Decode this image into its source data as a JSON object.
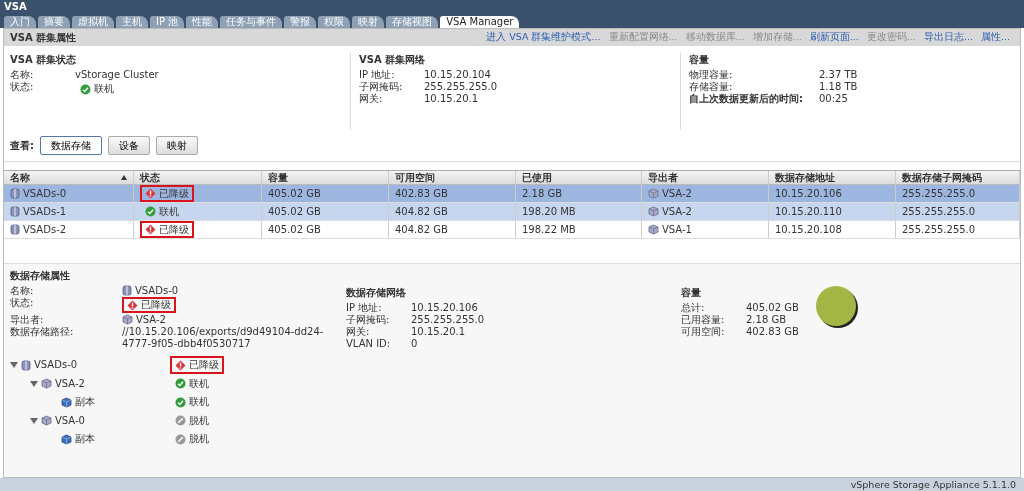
{
  "window": {
    "title": "VSA"
  },
  "tabs": [
    {
      "label": "入门",
      "selected": false
    },
    {
      "label": "摘要",
      "selected": false
    },
    {
      "label": "虚拟机",
      "selected": false
    },
    {
      "label": "主机",
      "selected": false
    },
    {
      "label": "IP 池",
      "selected": false
    },
    {
      "label": "性能",
      "selected": false
    },
    {
      "label": "任务与事件",
      "selected": false
    },
    {
      "label": "警报",
      "selected": false
    },
    {
      "label": "权限",
      "selected": false
    },
    {
      "label": "映射",
      "selected": false
    },
    {
      "label": "存储视图",
      "selected": false
    },
    {
      "label": "VSA Manager",
      "selected": true
    }
  ],
  "cluster_panel": {
    "title": "VSA 群集属性",
    "actions": [
      {
        "label": "进入 VSA 群集维护模式...",
        "disabled": false
      },
      {
        "label": "重新配置网络...",
        "disabled": true
      },
      {
        "label": "移动数据库...",
        "disabled": true
      },
      {
        "label": "增加存储...",
        "disabled": true
      },
      {
        "label": "刷新页面...",
        "disabled": false
      },
      {
        "label": "更改密码...",
        "disabled": true
      },
      {
        "label": "导出日志...",
        "disabled": false
      },
      {
        "label": "属性...",
        "disabled": false
      }
    ],
    "status": {
      "heading": "VSA 群集状态",
      "name_label": "名称:",
      "name": "vStorage Cluster",
      "state_label": "状态:",
      "state": {
        "kind": "online",
        "text": "联机",
        "highlighted": false
      }
    },
    "network": {
      "heading": "VSA 群集网络",
      "fields": [
        {
          "label": "IP 地址:",
          "value": "10.15.20.104"
        },
        {
          "label": "子网掩码:",
          "value": "255.255.255.0"
        },
        {
          "label": "网关:",
          "value": "10.15.20.1"
        }
      ]
    },
    "capacity": {
      "heading": "容量",
      "fields": [
        {
          "label": "物理容量:",
          "value": "2.37 TB",
          "bold": false
        },
        {
          "label": "存储容量:",
          "value": "1.18 TB",
          "bold": false
        },
        {
          "label": "自上次数据更新后的时间:",
          "value": "00:25",
          "bold": true
        }
      ]
    }
  },
  "view": {
    "label": "查看:",
    "buttons": [
      {
        "label": "数据存储",
        "selected": true
      },
      {
        "label": "设备",
        "selected": false
      },
      {
        "label": "映射",
        "selected": false
      }
    ]
  },
  "table": {
    "columns": [
      {
        "label": "名称",
        "sorted": true
      },
      {
        "label": "状态",
        "sorted": false
      },
      {
        "label": "容量",
        "sorted": false
      },
      {
        "label": "可用空间",
        "sorted": false
      },
      {
        "label": "已使用",
        "sorted": false
      },
      {
        "label": "导出者",
        "sorted": false
      },
      {
        "label": "数据存储地址",
        "sorted": false
      },
      {
        "label": "数据存储子网掩码",
        "sorted": false
      }
    ],
    "rows": [
      {
        "name": "VSADs-0",
        "status": {
          "kind": "degraded",
          "text": "已降级",
          "highlighted": true
        },
        "capacity": "405.02 GB",
        "free": "402.83 GB",
        "used": "2.18 GB",
        "exporter": "VSA-2",
        "address": "10.15.20.106",
        "mask": "255.255.255.0",
        "selected": true,
        "hovered": false
      },
      {
        "name": "VSADs-1",
        "status": {
          "kind": "online",
          "text": "联机",
          "highlighted": false
        },
        "capacity": "405.02 GB",
        "free": "404.82 GB",
        "used": "198.20 MB",
        "exporter": "VSA-2",
        "address": "10.15.20.110",
        "mask": "255.255.255.0",
        "selected": false,
        "hovered": true
      },
      {
        "name": "VSADs-2",
        "status": {
          "kind": "degraded",
          "text": "已降级",
          "highlighted": true
        },
        "capacity": "405.02 GB",
        "free": "404.82 GB",
        "used": "198.22 MB",
        "exporter": "VSA-1",
        "address": "10.15.20.108",
        "mask": "255.255.255.0",
        "selected": false,
        "hovered": false
      }
    ]
  },
  "datastore_panel": {
    "title": "数据存储属性",
    "fields": [
      {
        "label": "名称:",
        "kind": "datastore",
        "value": "VSADs-0"
      },
      {
        "label": "状态:",
        "kind": "status",
        "status": {
          "kind": "degraded",
          "text": "已降级",
          "highlighted": true
        }
      },
      {
        "label": "导出者:",
        "kind": "appliance",
        "value": "VSA-2"
      },
      {
        "label": "数据存储路径:",
        "kind": "text",
        "value": "//10.15.20.106/exports/d9d49104-dd24-4777-9f05-dbb4f0530717"
      }
    ],
    "network": {
      "heading": "数据存储网络",
      "fields": [
        {
          "label": "IP 地址:",
          "value": "10.15.20.106"
        },
        {
          "label": "子网掩码:",
          "value": "255.255.255.0"
        },
        {
          "label": "网关:",
          "value": "10.15.20.1"
        },
        {
          "label": "VLAN ID:",
          "value": "0"
        }
      ]
    },
    "capacity": {
      "heading": "容量",
      "fields": [
        {
          "label": "总计:",
          "value": "405.02 GB"
        },
        {
          "label": "已用容量:",
          "value": "2.18 GB"
        },
        {
          "label": "可用空间:",
          "value": "402.83 GB"
        }
      ]
    },
    "tree": [
      {
        "name": "VSADs-0",
        "kind": "datastore",
        "expanded": true,
        "status": {
          "kind": "degraded",
          "text": "已降级",
          "highlighted": true
        },
        "children": [
          {
            "name": "VSA-2",
            "kind": "appliance",
            "expanded": true,
            "status": {
              "kind": "online",
              "text": "联机",
              "highlighted": false
            },
            "children": [
              {
                "name": "副本",
                "kind": "replica",
                "status": {
                  "kind": "online",
                  "text": "联机",
                  "highlighted": false
                }
              }
            ]
          },
          {
            "name": "VSA-0",
            "kind": "appliance",
            "expanded": true,
            "status": {
              "kind": "offline",
              "text": "脱机",
              "highlighted": false
            },
            "children": [
              {
                "name": "副本",
                "kind": "replica",
                "status": {
                  "kind": "offline",
                  "text": "脱机",
                  "highlighted": false
                }
              }
            ]
          }
        ]
      }
    ]
  },
  "status_bar": {
    "text": "vSphere Storage Appliance 5.1.1.0"
  }
}
